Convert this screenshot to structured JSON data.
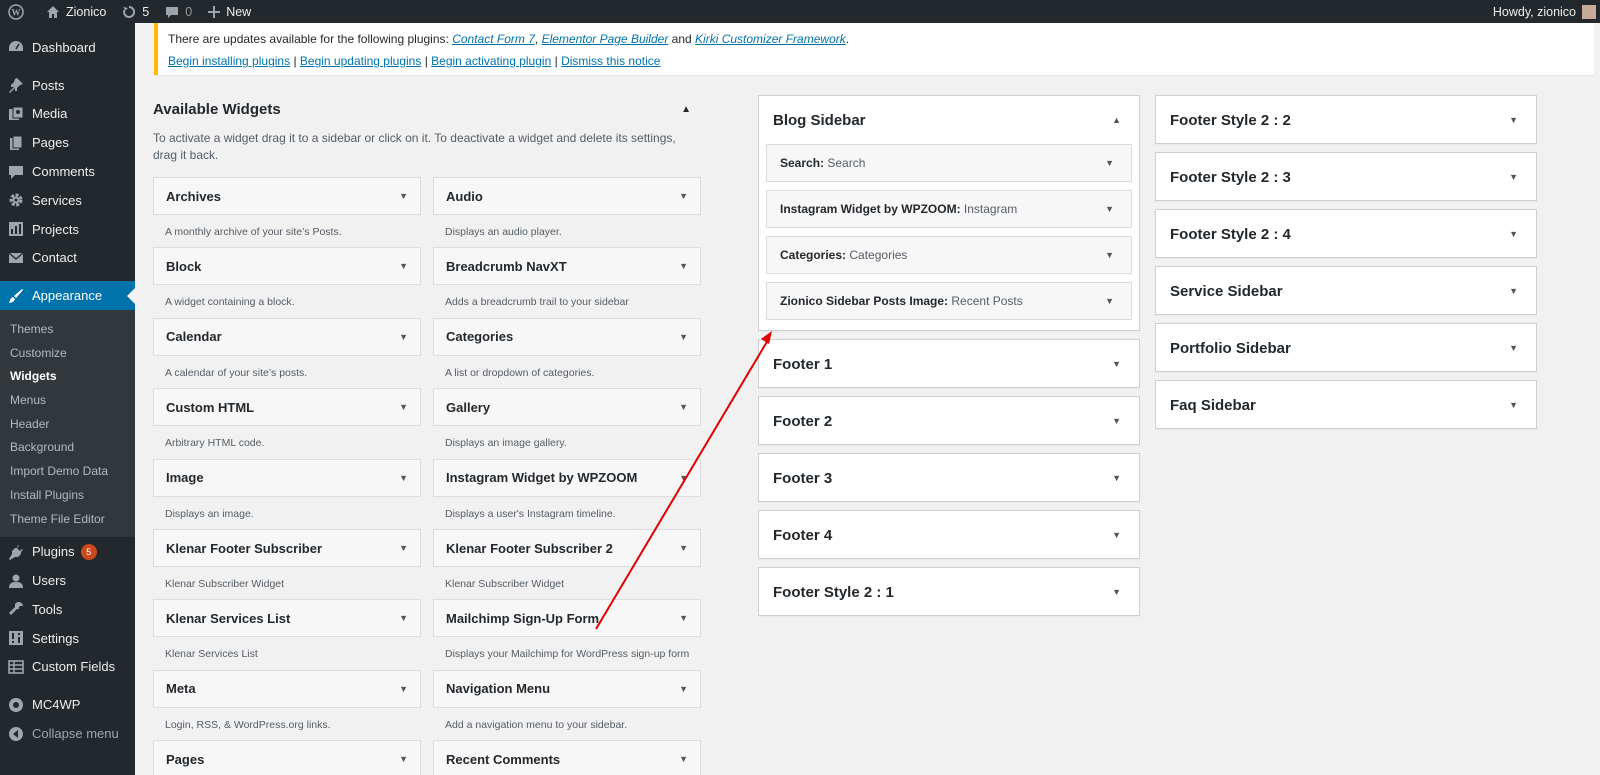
{
  "adminbar": {
    "site_name": "Zionico",
    "updates_count": "5",
    "comments_count": "0",
    "new_label": "New",
    "howdy": "Howdy, zionico"
  },
  "menu": {
    "dashboard": "Dashboard",
    "posts": "Posts",
    "media": "Media",
    "pages": "Pages",
    "comments": "Comments",
    "services": "Services",
    "projects": "Projects",
    "contact": "Contact",
    "appearance": "Appearance",
    "sub": [
      "Themes",
      "Customize",
      "Widgets",
      "Menus",
      "Header",
      "Background",
      "Import Demo Data",
      "Install Plugins",
      "Theme File Editor"
    ],
    "plugins": "Plugins",
    "plugins_badge": "5",
    "users": "Users",
    "tools": "Tools",
    "settings": "Settings",
    "custom_fields": "Custom Fields",
    "mc4wp": "MC4WP",
    "collapse": "Collapse menu"
  },
  "notice": {
    "text": "There are updates available for the following plugins:",
    "plugin1": "Contact Form 7",
    "sep1": ",",
    "plugin2": "Elementor Page Builder",
    "and": "and",
    "plugin3": "Kirki Customizer Framework",
    "end": ".",
    "link_install": "Begin installing plugins",
    "link_update": "Begin updating plugins",
    "link_activate": "Begin activating plugin",
    "link_dismiss": "Dismiss this notice",
    "pipe": "|"
  },
  "available": {
    "title": "Available Widgets",
    "description": "To activate a widget drag it to a sidebar or click on it. To deactivate a widget and delete its settings, drag it back.",
    "widgets": [
      {
        "name": "Archives",
        "desc": "A monthly archive of your site’s Posts."
      },
      {
        "name": "Audio",
        "desc": "Displays an audio player."
      },
      {
        "name": "Block",
        "desc": "A widget containing a block."
      },
      {
        "name": "Breadcrumb NavXT",
        "desc": "Adds a breadcrumb trail to your sidebar"
      },
      {
        "name": "Calendar",
        "desc": "A calendar of your site’s posts."
      },
      {
        "name": "Categories",
        "desc": "A list or dropdown of categories."
      },
      {
        "name": "Custom HTML",
        "desc": "Arbitrary HTML code."
      },
      {
        "name": "Gallery",
        "desc": "Displays an image gallery."
      },
      {
        "name": "Image",
        "desc": "Displays an image."
      },
      {
        "name": "Instagram Widget by WPZOOM",
        "desc": "Displays a user's Instagram timeline."
      },
      {
        "name": "Klenar Footer Subscriber",
        "desc": "Klenar Subscriber Widget"
      },
      {
        "name": "Klenar Footer Subscriber 2",
        "desc": "Klenar Subscriber Widget"
      },
      {
        "name": "Klenar Services List",
        "desc": "Klenar Services List"
      },
      {
        "name": "Mailchimp Sign-Up Form",
        "desc": "Displays your Mailchimp for WordPress sign-up form"
      },
      {
        "name": "Meta",
        "desc": "Login, RSS, & WordPress.org links."
      },
      {
        "name": "Navigation Menu",
        "desc": "Add a navigation menu to your sidebar."
      },
      {
        "name": "Pages",
        "desc": ""
      },
      {
        "name": "Recent Comments",
        "desc": ""
      }
    ]
  },
  "blog_sidebar": {
    "title": "Blog Sidebar",
    "widgets": [
      {
        "name": "Search:",
        "sub": "Search"
      },
      {
        "name": "Instagram Widget by WPZOOM:",
        "sub": "Instagram"
      },
      {
        "name": "Categories:",
        "sub": "Categories"
      },
      {
        "name": "Zionico Sidebar Posts Image:",
        "sub": "Recent Posts"
      }
    ]
  },
  "sidebars_col1": [
    "Footer 1",
    "Footer 2",
    "Footer 3",
    "Footer 4",
    "Footer Style 2 : 1"
  ],
  "sidebars_col2": [
    "Footer Style 2 : 2",
    "Footer Style 2 : 3",
    "Footer Style 2 : 4",
    "Service Sidebar",
    "Portfolio Sidebar",
    "Faq Sidebar"
  ],
  "colors": {
    "admin_dark": "#23282d",
    "accent": "#0073aa",
    "notice_warning": "#ffb900",
    "badge": "#ca4a1f",
    "annotation_arrow": "#e00000"
  }
}
